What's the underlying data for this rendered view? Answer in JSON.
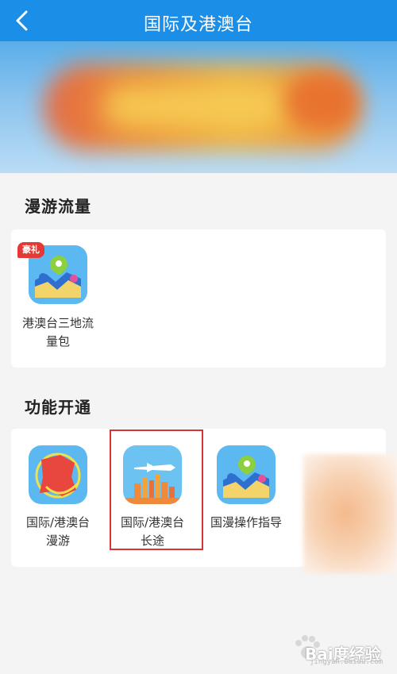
{
  "header": {
    "title": "国际及港澳台"
  },
  "sections": [
    {
      "title": "漫游流量"
    },
    {
      "title": "功能开通"
    }
  ],
  "roaming": {
    "badge": "豪礼",
    "items": [
      {
        "label_line1": "港澳台三地流",
        "label_line2": "量包",
        "icon": "map-pin-wifi-icon"
      }
    ]
  },
  "functions": {
    "items": [
      {
        "label_line1": "国际/港澳台",
        "label_line2": "漫游",
        "icon": "globe-map-icon"
      },
      {
        "label_line1": "国际/港澳台",
        "label_line2": "长途",
        "icon": "airplane-city-icon"
      },
      {
        "label_line1": "国漫操作指导",
        "label_line2": "",
        "icon": "map-pin-wifi-icon"
      }
    ]
  },
  "watermark": {
    "text": "Bai度经验",
    "sub": "jingyan.baidu.com"
  },
  "colors": {
    "header": "#1b8ee8",
    "highlight": "#d43535",
    "badge": "#e53935"
  }
}
